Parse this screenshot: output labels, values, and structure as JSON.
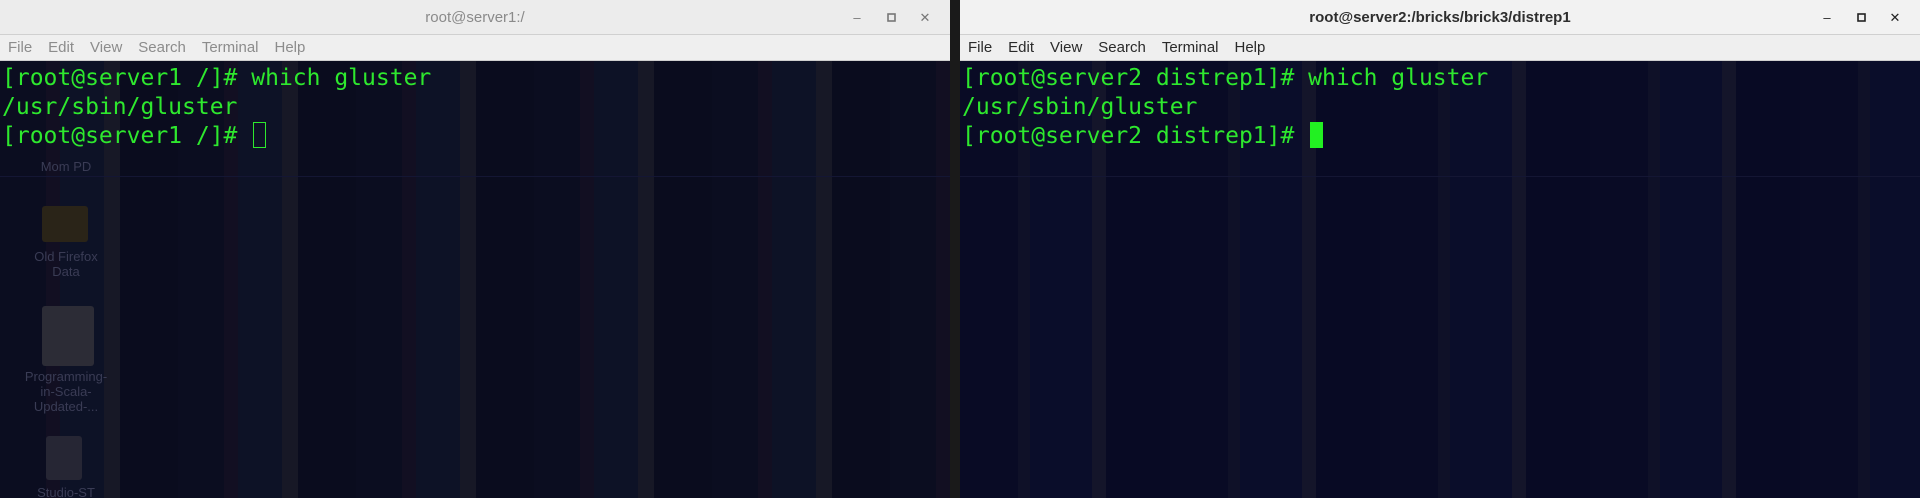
{
  "windows": [
    {
      "title": "root@server1:/",
      "active": false,
      "menu": [
        "File",
        "Edit",
        "View",
        "Search",
        "Terminal",
        "Help"
      ],
      "lines": [
        "[root@server1 /]# which gluster",
        "/usr/sbin/gluster",
        "[root@server1 /]# "
      ],
      "cursor_style": "hollow"
    },
    {
      "title": "root@server2:/bricks/brick3/distrep1",
      "active": true,
      "menu": [
        "File",
        "Edit",
        "View",
        "Search",
        "Terminal",
        "Help"
      ],
      "lines": [
        "[root@server2 distrep1]# which gluster",
        "/usr/sbin/gluster",
        "[root@server2 distrep1]# "
      ],
      "cursor_style": "solid"
    }
  ],
  "window_controls": {
    "minimize": "–",
    "maximize": "▫",
    "close": "✕"
  },
  "desktop_icons": [
    {
      "label": "Mom PD"
    },
    {
      "label": "Old Firefox Data"
    },
    {
      "label": "Programming-in-Scala-Updated-..."
    },
    {
      "label": "Studio-ST"
    }
  ],
  "colors": {
    "terminal_fg": "#2ee82e",
    "terminal_bg": "#0a0c22",
    "cursor": "#22f022"
  }
}
